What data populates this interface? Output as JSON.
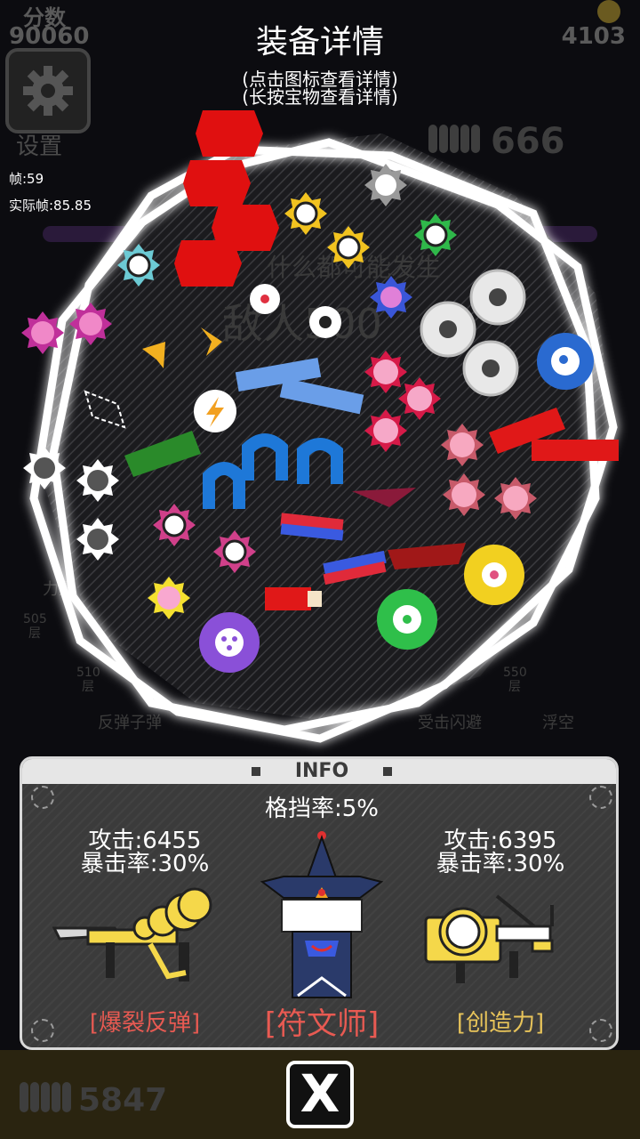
{
  "hud": {
    "score_label": "分数",
    "score_value": "90060",
    "coin_value": "4103",
    "settings_label": "设置",
    "fps_label": "帧:59",
    "real_fps_label": "实际帧:85.85",
    "ammo_top": "666",
    "ammo_bottom": "5847"
  },
  "background_text": {
    "warning": "什么都可能发生",
    "enemies": "敌人500",
    "skills": [
      {
        "floor": "505",
        "unit": "层",
        "name": "力量"
      },
      {
        "floor": "510",
        "unit": "层",
        "name": "反弹子弹"
      },
      {
        "floor": "550",
        "unit": "层",
        "name": "浮空"
      },
      {
        "name": "受击闪避"
      }
    ]
  },
  "header": {
    "title": "装备详情",
    "hint_1": "(点击图标查看详情)",
    "hint_2": "(长按宝物查看详情)"
  },
  "info_panel": {
    "label": "INFO",
    "block_rate": "格挡率:5%",
    "left_weapon": {
      "attack": "攻击:6455",
      "crit": "暴击率:30%",
      "name": "[爆裂反弹]"
    },
    "character": {
      "name": "[符文师]"
    },
    "right_weapon": {
      "attack": "攻击:6395",
      "crit": "暴击率:30%",
      "name": "[创造力]"
    }
  },
  "close_button": {
    "label": "X"
  },
  "colors": {
    "panel_bg": "#3b3b3b",
    "panel_border": "#d8d8d8",
    "left_name": "#e85a52",
    "character_name": "#e85a52",
    "right_name": "#e8c45a",
    "weapon_gold": "#f5d84a"
  }
}
